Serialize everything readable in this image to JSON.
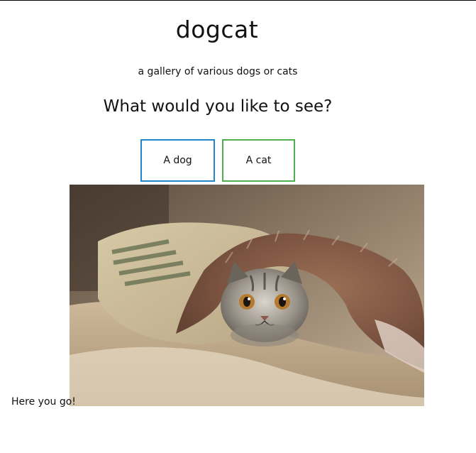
{
  "header": {
    "title": "dogcat",
    "subtitle": "a gallery of various dogs or cats",
    "question": "What would you like to see?"
  },
  "buttons": {
    "dog": {
      "label": "A dog",
      "border_color": "#1f87c9"
    },
    "cat": {
      "label": "A cat",
      "border_color": "#4caf50"
    }
  },
  "gallery": {
    "image_icon": "cat-under-blanket-image"
  },
  "result": {
    "message": "Here you go!"
  }
}
